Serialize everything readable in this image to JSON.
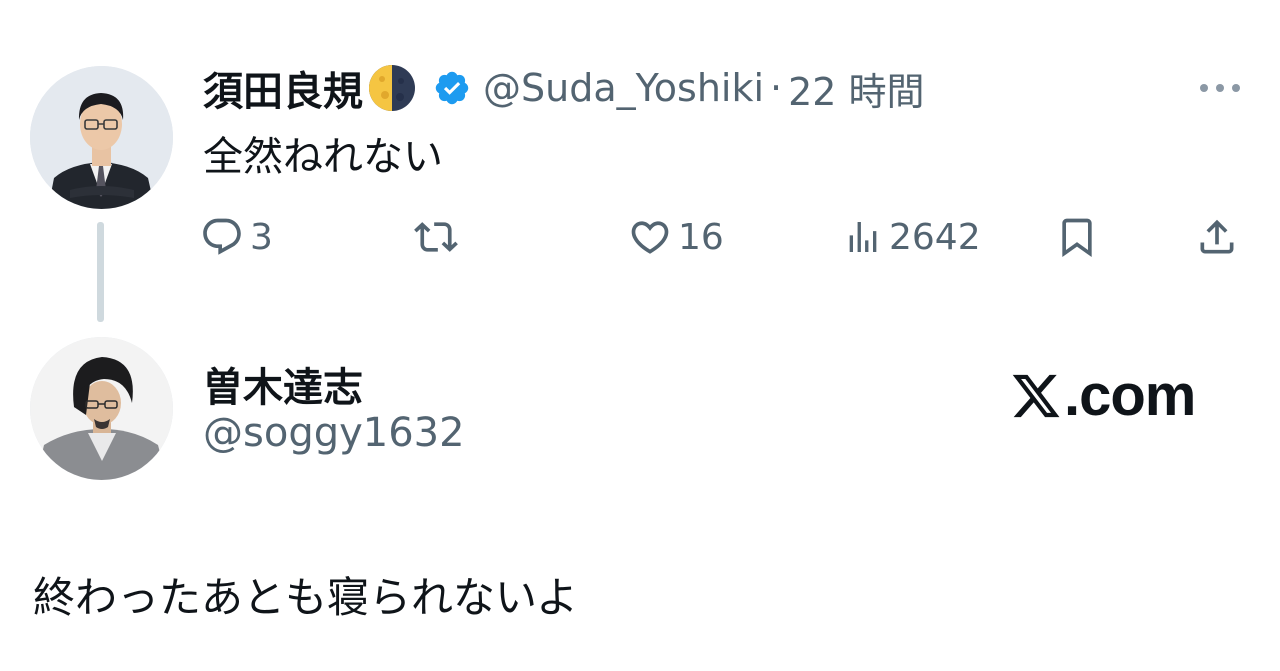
{
  "tweet": {
    "author": {
      "display_name": "須田良規",
      "emoji": "moon-phase-emoji",
      "verified": true,
      "handle": "@Suda_Yoshiki",
      "separator": "·",
      "time": "22 時間"
    },
    "text": "全然ねれない",
    "actions": {
      "reply_count": "3",
      "retweet_count": "",
      "like_count": "16",
      "view_count": "2642"
    },
    "icons": {
      "reply": "reply-icon",
      "retweet": "retweet-icon",
      "like": "heart-icon",
      "views": "views-icon",
      "bookmark": "bookmark-icon",
      "share": "share-icon",
      "more": "more-icon",
      "verified": "verified-badge-icon"
    }
  },
  "reply": {
    "author": {
      "display_name": "曽木達志",
      "handle": "@soggy1632"
    },
    "text": "終わったあとも寝られないよ"
  },
  "branding": {
    "logo_text": ".com",
    "logo_icon": "x-logo-icon"
  },
  "colors": {
    "text_primary": "#0f1419",
    "text_secondary": "#536471",
    "verified_blue": "#1d9bf0",
    "thread_line": "#cfd9de"
  }
}
